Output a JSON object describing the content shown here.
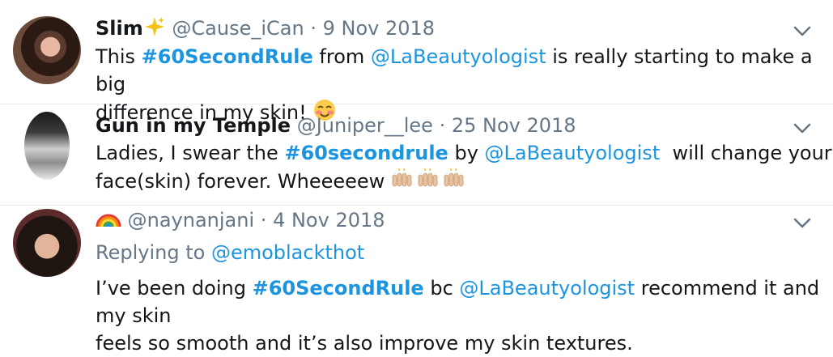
{
  "tweets": [
    {
      "display_name": "Slim",
      "handle": "@Cause_iCan",
      "separator": "·",
      "date": "9 Nov 2018",
      "text_parts": [
        "This ",
        "#60SecondRule",
        " from ",
        "@LaBeautyologist",
        " is really starting to make a big",
        "difference in my skin! "
      ],
      "emoji_name": "smiling-face-with-blush-icon"
    },
    {
      "display_name": "Gun in my Temple",
      "handle": "@Juniper__lee",
      "separator": "·",
      "date": "25 Nov 2018",
      "text_parts": [
        "Ladies, I swear the ",
        "#60secondrule",
        " by ",
        "@LaBeautyologist",
        "  will change your",
        "face(skin) forever. Wheeeeew "
      ],
      "emoji_name": "raising-hands-icon"
    },
    {
      "handle": "@naynanjani",
      "separator": "·",
      "date": "4 Nov 2018",
      "replying_label": "Replying to ",
      "replying_to": "@emoblackthot",
      "text_parts": [
        "I’ve been doing ",
        "#60SecondRule",
        " bc ",
        "@LaBeautyologist",
        " recommend it and my skin",
        "feels so smooth and it’s also improve my skin textures."
      ],
      "name_emoji": "rainbow-icon"
    }
  ],
  "colors": {
    "link": "#1b95e0",
    "muted": "#657786",
    "text": "#14171a"
  }
}
